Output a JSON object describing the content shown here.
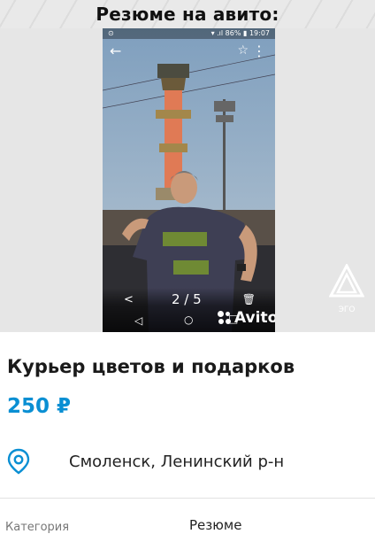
{
  "banner": {
    "title": "Резюме на авито:"
  },
  "phone": {
    "status_left": "⊙",
    "status_right": "▾ .ıl 86% ▮ 19:07",
    "counter": "2 / 5",
    "brand": "Avito",
    "icons": [
      "back-arrow-icon",
      "star-icon",
      "more-icon",
      "share-icon",
      "trash-icon",
      "nav-back-icon",
      "nav-home-icon",
      "nav-recent-icon"
    ]
  },
  "watermark": {
    "label": "ЭГО"
  },
  "listing": {
    "title": "Курьер цветов и подарков",
    "price": "250 ₽",
    "location": "Смоленск, Ленинский р-н",
    "spec_label": "Категория",
    "spec_value": "Резюме"
  },
  "colors": {
    "price": "#0a8fd3",
    "location_icon": "#0a8fd3"
  }
}
